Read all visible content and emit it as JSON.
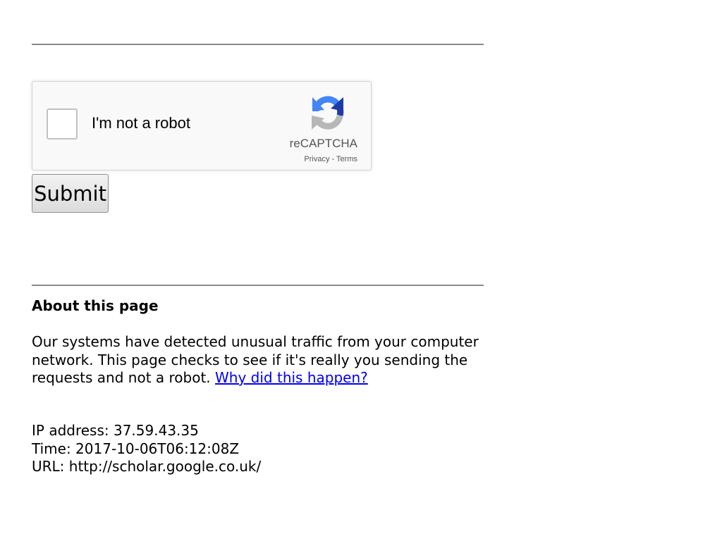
{
  "recaptcha": {
    "label": "I'm not a robot",
    "brand": "reCAPTCHA",
    "privacy_link": "Privacy",
    "separator": " - ",
    "terms_link": "Terms"
  },
  "form": {
    "submit_label": "Submit"
  },
  "about": {
    "heading": "About this page",
    "text": "Our systems have detected unusual traffic from your computer network. This page checks to see if it's really you sending the requests and not a robot.",
    "link": "Why did this happen?"
  },
  "info": {
    "ip": "IP address: 37.59.43.35",
    "time": "Time: 2017-10-06T06:12:08Z",
    "url": "URL: http://scholar.google.co.uk/"
  },
  "colors": {
    "link": "#0000ee",
    "recaptcha_blue_dark": "#1c3aa9",
    "recaptcha_blue": "#4285f4",
    "recaptcha_gray": "#b7b7b7"
  }
}
